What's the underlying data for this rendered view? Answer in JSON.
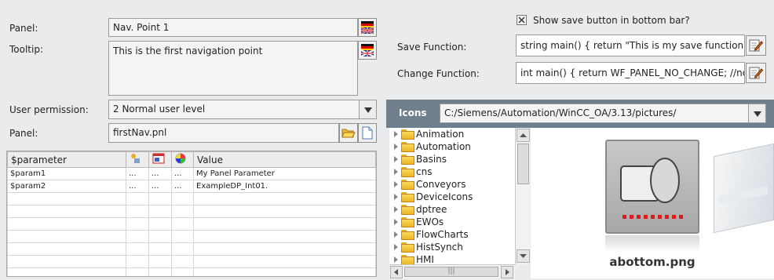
{
  "form": {
    "panel_label": "Panel:",
    "panel_value": "Nav. Point 1",
    "tooltip_label": "Tooltip:",
    "tooltip_value": "This is the first navigation point",
    "user_permission_label": "User permission:",
    "user_permission_value": "2 Normal user level",
    "panel_file_label": "Panel:",
    "panel_file_value": "firstNav.pnl"
  },
  "params_table": {
    "columns": [
      "$parameter",
      "",
      "",
      "",
      "Value"
    ],
    "rows": [
      {
        "name": "$param1",
        "c1": "...",
        "c2": "...",
        "c3": "...",
        "value": "My Panel Parameter"
      },
      {
        "name": "$param2",
        "c1": "...",
        "c2": "...",
        "c3": "...",
        "value": "ExampleDP_Int01."
      },
      {
        "name": "",
        "c1": "",
        "c2": "",
        "c3": "",
        "value": ""
      },
      {
        "name": "",
        "c1": "",
        "c2": "",
        "c3": "",
        "value": ""
      },
      {
        "name": "",
        "c1": "",
        "c2": "",
        "c3": "",
        "value": ""
      },
      {
        "name": "",
        "c1": "",
        "c2": "",
        "c3": "",
        "value": ""
      },
      {
        "name": "",
        "c1": "",
        "c2": "",
        "c3": "",
        "value": ""
      },
      {
        "name": "",
        "c1": "",
        "c2": "",
        "c3": "",
        "value": ""
      },
      {
        "name": "",
        "c1": "",
        "c2": "",
        "c3": "",
        "value": ""
      }
    ]
  },
  "save": {
    "checkbox_label": "Show save button in bottom bar?",
    "checked": true,
    "save_function_label": "Save Function:",
    "save_function_value": "string  main() {   return \"This is my save function\"; }",
    "change_function_label": "Change Function:",
    "change_function_value": "int main() {   return WF_PANEL_NO_CHANGE; //no ch"
  },
  "icons": {
    "title": "Icons",
    "path": "C:/Siemens/Automation/WinCC_OA/3.13/pictures/",
    "folders": [
      "Animation",
      "Automation",
      "Basins",
      "cns",
      "Conveyors",
      "DeviceIcons",
      "dptree",
      "EWOs",
      "FlowCharts",
      "HistSynch",
      "HMI"
    ],
    "preview_caption": "abottom.png"
  },
  "colors": {
    "icons_header": "#6f7f8c",
    "background": "#eaebec"
  }
}
